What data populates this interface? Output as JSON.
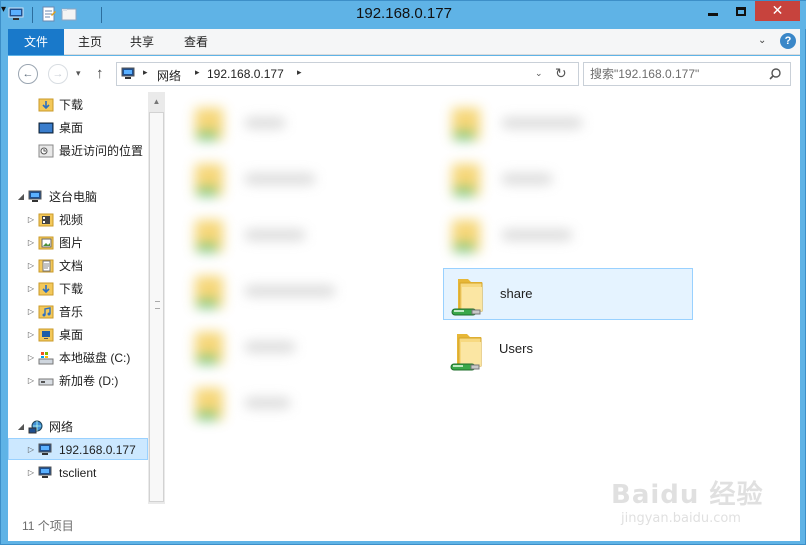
{
  "window": {
    "title": "192.168.0.177"
  },
  "quick_access": {
    "dropdown": "▾"
  },
  "window_buttons": {
    "close": "✕"
  },
  "ribbon": {
    "tabs": [
      {
        "label": "文件",
        "active": true
      },
      {
        "label": "主页"
      },
      {
        "label": "共享"
      },
      {
        "label": "查看"
      }
    ],
    "expand": "⌄",
    "help": "?"
  },
  "navbar": {
    "back": "←",
    "forward": "→",
    "history": "▾",
    "up": "↑",
    "breadcrumb": [
      "网络",
      "192.168.0.177"
    ],
    "crumb_sep": "▸",
    "dropdown": "⌄",
    "refresh": "↻",
    "search_placeholder": "搜索\"192.168.0.177\""
  },
  "nav_pane": {
    "favorites": [
      {
        "label": "下载",
        "icon": "download-folder-icon"
      },
      {
        "label": "桌面",
        "icon": "desktop-icon"
      },
      {
        "label": "最近访问的位置",
        "icon": "recent-places-icon"
      }
    ],
    "this_pc": {
      "label": "这台电脑",
      "items": [
        {
          "label": "视频",
          "icon": "videos-folder-icon"
        },
        {
          "label": "图片",
          "icon": "pictures-folder-icon"
        },
        {
          "label": "文档",
          "icon": "documents-folder-icon"
        },
        {
          "label": "下载",
          "icon": "download-folder-icon"
        },
        {
          "label": "音乐",
          "icon": "music-folder-icon"
        },
        {
          "label": "桌面",
          "icon": "desktop-icon"
        },
        {
          "label": "本地磁盘 (C:)",
          "icon": "local-disk-icon"
        },
        {
          "label": "新加卷 (D:)",
          "icon": "drive-icon"
        }
      ]
    },
    "network": {
      "label": "网络",
      "items": [
        {
          "label": "192.168.0.177",
          "icon": "network-computer-icon",
          "selected": true
        },
        {
          "label": "tsclient",
          "icon": "network-computer-icon"
        }
      ]
    },
    "expander_collapsed": "▷",
    "expander_expanded": "◢"
  },
  "scrollbar": {
    "up": "▲"
  },
  "files": {
    "visible": [
      {
        "name": "share",
        "selected": true
      },
      {
        "name": "Users"
      }
    ]
  },
  "status": {
    "item_count": "11 个项目"
  },
  "watermark": {
    "text": "Baidu 经验",
    "url": "jingyan.baidu.com"
  }
}
